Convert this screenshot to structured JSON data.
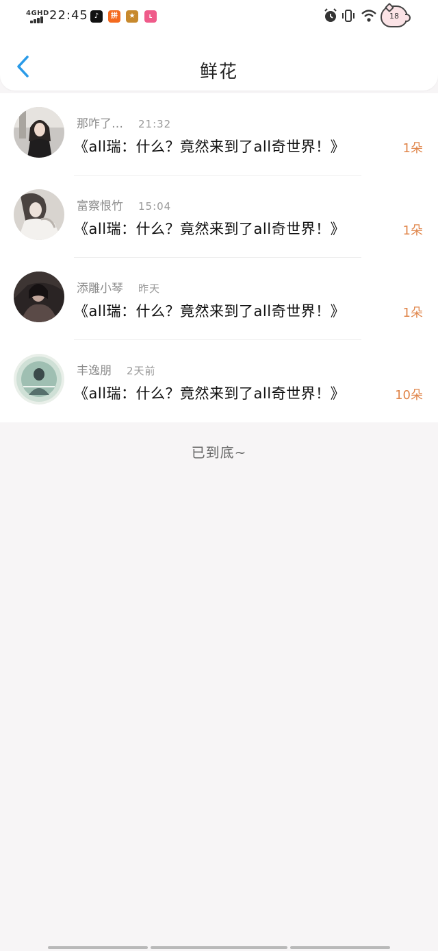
{
  "status": {
    "network": "4GHD",
    "time": "22:45",
    "battery": "18"
  },
  "nav": {
    "title": "鲜花",
    "back_icon": "chevron-left-icon"
  },
  "gifts": [
    {
      "user": "那咋了…",
      "time": "21:32",
      "message": "《all瑞：什么？竟然来到了all奇世界！》",
      "quantity": "1朵"
    },
    {
      "user": "富察恨竹",
      "time": "15:04",
      "message": "《all瑞：什么？竟然来到了all奇世界！》",
      "quantity": "1朵"
    },
    {
      "user": "添雕小琴",
      "time": "昨天",
      "message": "《all瑞：什么？竟然来到了all奇世界！》",
      "quantity": "1朵"
    },
    {
      "user": "丰逸朋",
      "time": "2天前",
      "message": "《all瑞：什么？竟然来到了all奇世界！》",
      "quantity": "10朵"
    }
  ],
  "footer": {
    "end_text": "已到底~"
  },
  "colors": {
    "accent": "#2a9be8",
    "quantity": "#e0854a",
    "background": "#f7f5f6"
  }
}
